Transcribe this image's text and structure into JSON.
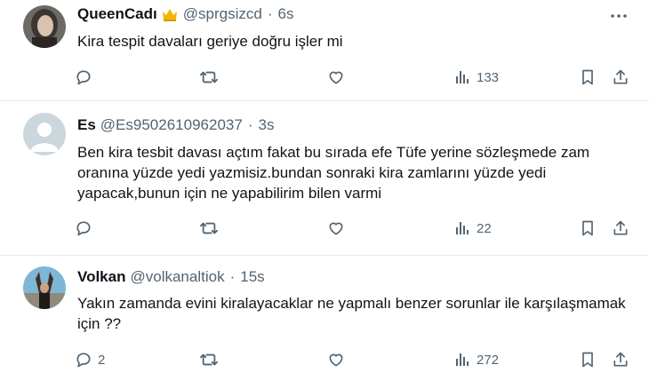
{
  "tweets": [
    {
      "author": "QueenCadı",
      "handle": "@sprgsizcd",
      "separator": "·",
      "time": "6s",
      "text": "Kira tespit davaları geriye doğru işler mi",
      "replies": "",
      "reposts": "",
      "likes": "",
      "views": "133",
      "badge_icon": "crown-icon"
    },
    {
      "author": "Es",
      "handle": "@Es9502610962037",
      "separator": "·",
      "time": "3s",
      "text": "Ben kira tesbit davası açtım fakat bu sırada efe Tüfe yerine sözleşmede zam oranına yüzde yedi yazmisiz.bundan sonraki kira zamlarını yüzde yedi yapacak,bunun için ne yapabilirim bilen varmi",
      "replies": "",
      "reposts": "",
      "likes": "",
      "views": "22"
    },
    {
      "author": "Volkan",
      "handle": "@volkanaltiok",
      "separator": "·",
      "time": "15s",
      "text": "Yakın zamanda evini kiralayacaklar ne yapmalı benzer sorunlar ile karşılaşmamak için ??",
      "replies": "2",
      "reposts": "",
      "likes": "",
      "views": "272"
    }
  ],
  "colors": {
    "text": "#0f1419",
    "muted": "#536471",
    "divider": "#e6ecf0",
    "crown": "#f4b400"
  },
  "icons": [
    "more-icon",
    "reply-icon",
    "repost-icon",
    "like-icon",
    "views-icon",
    "bookmark-icon",
    "share-icon",
    "crown-icon"
  ]
}
